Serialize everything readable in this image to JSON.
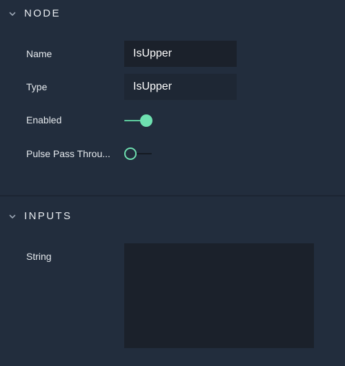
{
  "node_section": {
    "title": "NODE",
    "fields": {
      "name": {
        "label": "Name",
        "value": "IsUpper"
      },
      "type": {
        "label": "Type",
        "value": "IsUpper"
      },
      "enabled": {
        "label": "Enabled",
        "state": "on"
      },
      "pulse": {
        "label": "Pulse Pass Throu...",
        "state": "off"
      }
    }
  },
  "inputs_section": {
    "title": "INPUTS",
    "string": {
      "label": "String",
      "value": ""
    }
  },
  "colors": {
    "background": "#222d3d",
    "field_background": "#1b212b",
    "accent": "#6ee0b0",
    "text": "#e6eaee"
  },
  "icons": {
    "collapse": "chevron-down-icon"
  }
}
